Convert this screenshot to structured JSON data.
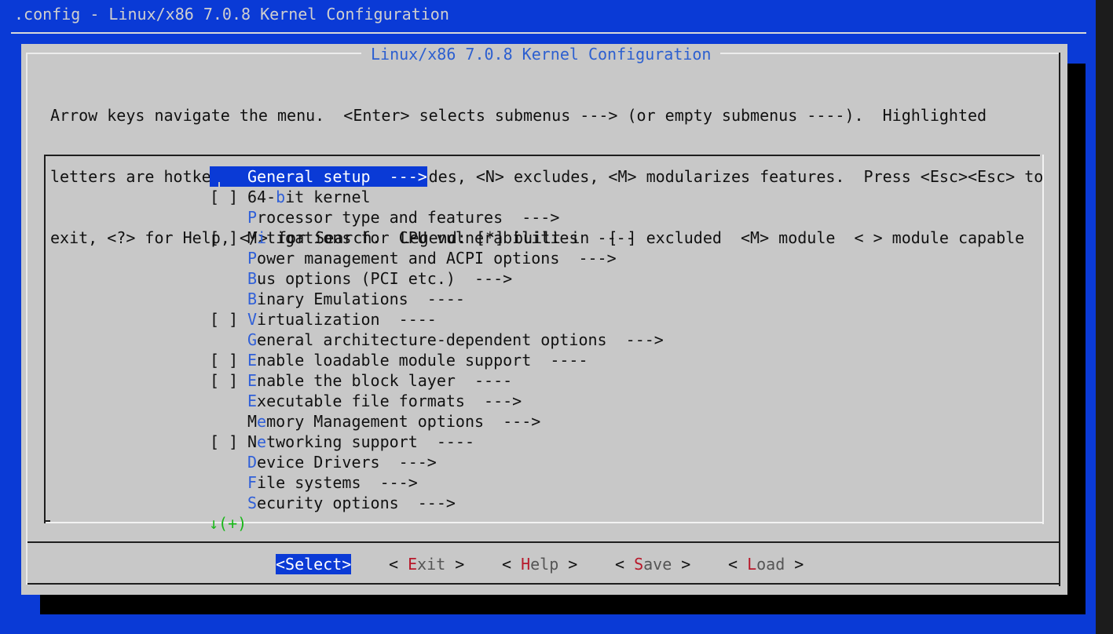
{
  "window": {
    "title": ".config - Linux/x86 7.0.8 Kernel Configuration"
  },
  "dialog": {
    "title": "Linux/x86 7.0.8 Kernel Configuration",
    "instructions": [
      "Arrow keys navigate the menu.  <Enter> selects submenus ---> (or empty submenus ----).  Highlighted",
      "letters are hotkeys.  Pressing <Y> includes, <N> excludes, <M> modularizes features.  Press <Esc><Esc> to",
      "exit, <?> for Help, </> for Search.  Legend: [*] built-in  [ ] excluded  <M> module  < > module capable"
    ]
  },
  "menu": {
    "items": [
      {
        "mark": "",
        "pre": "",
        "key": "G",
        "post": "eneral setup",
        "suffix": "  --->",
        "selected": true
      },
      {
        "mark": "[ ]",
        "pre": "64-",
        "key": "b",
        "post": "it kernel",
        "suffix": "",
        "selected": false
      },
      {
        "mark": "",
        "pre": "",
        "key": "P",
        "post": "rocessor type and features",
        "suffix": "  --->",
        "selected": false
      },
      {
        "mark": "[ ]",
        "pre": "M",
        "key": "i",
        "post": "tigations for CPU vulnerabilities",
        "suffix": "  ----",
        "selected": false
      },
      {
        "mark": "",
        "pre": "",
        "key": "P",
        "post": "ower management and ACPI options",
        "suffix": "  --->",
        "selected": false
      },
      {
        "mark": "",
        "pre": "",
        "key": "B",
        "post": "us options (PCI etc.)",
        "suffix": "  --->",
        "selected": false
      },
      {
        "mark": "",
        "pre": "",
        "key": "B",
        "post": "inary Emulations",
        "suffix": "  ----",
        "selected": false
      },
      {
        "mark": "[ ]",
        "pre": "",
        "key": "V",
        "post": "irtualization",
        "suffix": "  ----",
        "selected": false
      },
      {
        "mark": "",
        "pre": "",
        "key": "G",
        "post": "eneral architecture-dependent options",
        "suffix": "  --->",
        "selected": false
      },
      {
        "mark": "[ ]",
        "pre": "",
        "key": "E",
        "post": "nable loadable module support",
        "suffix": "  ----",
        "selected": false
      },
      {
        "mark": "[ ]",
        "pre": "",
        "key": "E",
        "post": "nable the block layer",
        "suffix": "  ----",
        "selected": false
      },
      {
        "mark": "",
        "pre": "",
        "key": "E",
        "post": "xecutable file formats",
        "suffix": "  --->",
        "selected": false
      },
      {
        "mark": "",
        "pre": "M",
        "key": "e",
        "post": "mory Management options",
        "suffix": "  --->",
        "selected": false
      },
      {
        "mark": "[ ]",
        "pre": "N",
        "key": "e",
        "post": "tworking support",
        "suffix": "  ----",
        "selected": false
      },
      {
        "mark": "",
        "pre": "",
        "key": "D",
        "post": "evice Drivers",
        "suffix": "  --->",
        "selected": false
      },
      {
        "mark": "",
        "pre": "",
        "key": "F",
        "post": "ile systems",
        "suffix": "  --->",
        "selected": false
      },
      {
        "mark": "",
        "pre": "",
        "key": "S",
        "post": "ecurity options",
        "suffix": "  --->",
        "selected": false
      }
    ],
    "more_indicator": "↓(+)"
  },
  "buttons": [
    {
      "open": "<",
      "key": "",
      "rest": "Select",
      "close": ">",
      "active": true
    },
    {
      "open": "< ",
      "key": "E",
      "rest": "xit",
      "close": " >",
      "active": false
    },
    {
      "open": "< ",
      "key": "H",
      "rest": "elp",
      "close": " >",
      "active": false
    },
    {
      "open": "< ",
      "key": "S",
      "rest": "ave",
      "close": " >",
      "active": false
    },
    {
      "open": "< ",
      "key": "L",
      "rest": "oad",
      "close": " >",
      "active": false
    }
  ],
  "colors": {
    "terminal_bg": "#0a3ad6",
    "dialog_bg": "#c8c8c8",
    "menu_hotkey": "#2f5fd8",
    "button_hotkey": "#b8192b",
    "more_indicator": "#18b818"
  }
}
